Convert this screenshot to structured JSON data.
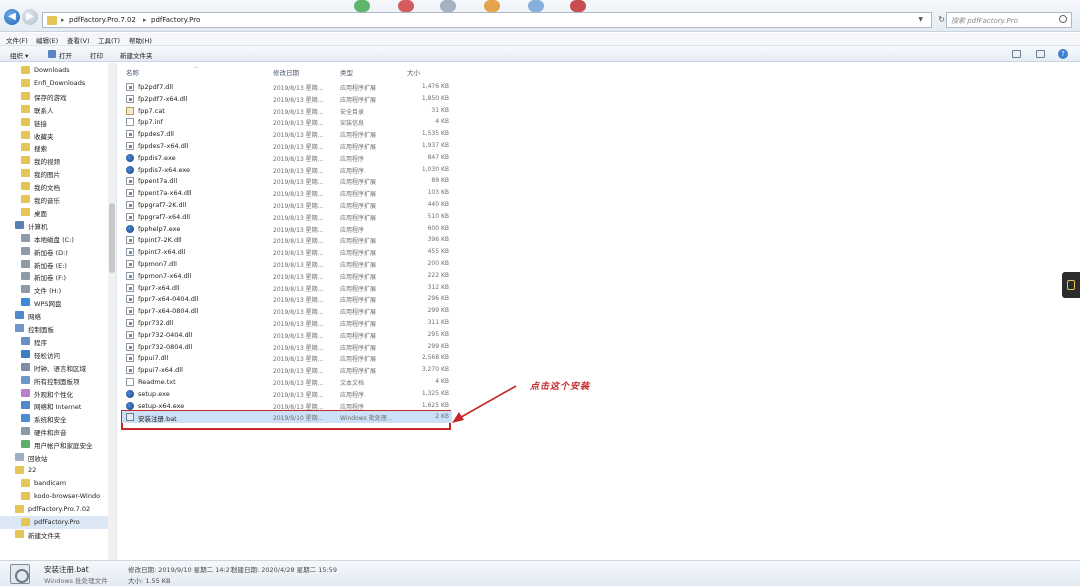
{
  "address": {
    "crumbs": [
      "pdfFactory.Pro.7.02",
      "pdfFactory.Pro"
    ],
    "search_placeholder": "搜索 pdfFactory.Pro"
  },
  "menu": [
    "文件(F)",
    "编辑(E)",
    "查看(V)",
    "工具(T)",
    "帮助(H)"
  ],
  "toolbar": {
    "organize": "组织 ▾",
    "open": "打开",
    "print": "打印",
    "new_folder": "新建文件夹"
  },
  "sidebar": {
    "items": [
      {
        "label": "Downloads",
        "icon": "folder-icon",
        "indent": 1
      },
      {
        "label": "Enfi_Downloads",
        "icon": "folder-icon",
        "indent": 1
      },
      {
        "label": "保存的游戏",
        "icon": "folder-icon",
        "indent": 1
      },
      {
        "label": "联系人",
        "icon": "folder-icon",
        "indent": 1
      },
      {
        "label": "链接",
        "icon": "folder-icon",
        "indent": 1
      },
      {
        "label": "收藏夹",
        "icon": "folder-icon",
        "indent": 1
      },
      {
        "label": "搜索",
        "icon": "folder-icon",
        "indent": 1
      },
      {
        "label": "我的视频",
        "icon": "folder-icon",
        "indent": 1
      },
      {
        "label": "我的图片",
        "icon": "folder-icon",
        "indent": 1
      },
      {
        "label": "我的文档",
        "icon": "folder-icon",
        "indent": 1
      },
      {
        "label": "我的音乐",
        "icon": "folder-icon",
        "indent": 1
      },
      {
        "label": "桌面",
        "icon": "folder-icon",
        "indent": 1
      },
      {
        "label": "计算机",
        "icon": "computer-icon",
        "indent": 0
      },
      {
        "label": "本地磁盘 (C:)",
        "icon": "drive-icon",
        "indent": 1
      },
      {
        "label": "新加卷 (D:)",
        "icon": "drive-icon",
        "indent": 1
      },
      {
        "label": "新加卷 (E:)",
        "icon": "drive-icon",
        "indent": 1
      },
      {
        "label": "新加卷 (F:)",
        "icon": "drive-icon",
        "indent": 1
      },
      {
        "label": "文件 (H:)",
        "icon": "drive-icon",
        "indent": 1
      },
      {
        "label": "WPS网盘",
        "icon": "cloud-icon",
        "indent": 1
      },
      {
        "label": "网络",
        "icon": "network-icon",
        "indent": 0
      },
      {
        "label": "控制面板",
        "icon": "control-panel-icon",
        "indent": 0
      },
      {
        "label": "程序",
        "icon": "programs-icon",
        "indent": 1
      },
      {
        "label": "轻松访问",
        "icon": "accessibility-icon",
        "indent": 1
      },
      {
        "label": "时钟、语言和区域",
        "icon": "clock-icon",
        "indent": 1
      },
      {
        "label": "所有控制面板项",
        "icon": "control-panel-icon",
        "indent": 1
      },
      {
        "label": "外观和个性化",
        "icon": "appearance-icon",
        "indent": 1
      },
      {
        "label": "网络和 Internet",
        "icon": "network-icon",
        "indent": 1
      },
      {
        "label": "系统和安全",
        "icon": "shield-icon",
        "indent": 1
      },
      {
        "label": "硬件和声音",
        "icon": "hardware-icon",
        "indent": 1
      },
      {
        "label": "用户帐户和家庭安全",
        "icon": "user-icon",
        "indent": 1
      },
      {
        "label": "回收站",
        "icon": "recycle-bin-icon",
        "indent": 0
      },
      {
        "label": "22",
        "icon": "folder-icon",
        "indent": 0
      },
      {
        "label": "bandicam",
        "icon": "folder-icon",
        "indent": 1
      },
      {
        "label": "kodo-browser-Windo",
        "icon": "folder-icon",
        "indent": 1
      },
      {
        "label": "pdfFactory.Pro.7.02",
        "icon": "folder-icon",
        "indent": 0
      },
      {
        "label": "pdfFactory.Pro",
        "icon": "folder-icon",
        "indent": 1,
        "selected": true
      },
      {
        "label": "新建文件夹",
        "icon": "folder-icon",
        "indent": 0
      }
    ]
  },
  "columns": {
    "name": "名称",
    "date": "修改日期",
    "type": "类型",
    "size": "大小"
  },
  "files": [
    {
      "name": "fp2pdf7.dll",
      "date": "2019/8/13 星期...",
      "type": "应用程序扩展",
      "size": "1,476 KB",
      "icon": "dll"
    },
    {
      "name": "fp2pdf7-x64.dll",
      "date": "2019/8/13 星期...",
      "type": "应用程序扩展",
      "size": "1,850 KB",
      "icon": "dll"
    },
    {
      "name": "fpp7.cat",
      "date": "2019/8/13 星期...",
      "type": "安全目录",
      "size": "31 KB",
      "icon": "cat"
    },
    {
      "name": "fpp7.inf",
      "date": "2019/8/13 星期...",
      "type": "安装信息",
      "size": "4 KB",
      "icon": "inf"
    },
    {
      "name": "fppdes7.dll",
      "date": "2019/8/13 星期...",
      "type": "应用程序扩展",
      "size": "1,535 KB",
      "icon": "dll"
    },
    {
      "name": "fppdes7-x64.dll",
      "date": "2019/8/13 星期...",
      "type": "应用程序扩展",
      "size": "1,937 KB",
      "icon": "dll"
    },
    {
      "name": "fppdis7.exe",
      "date": "2019/8/13 星期...",
      "type": "应用程序",
      "size": "847 KB",
      "icon": "exe"
    },
    {
      "name": "fppdis7-x64.exe",
      "date": "2019/8/13 星期...",
      "type": "应用程序",
      "size": "1,030 KB",
      "icon": "exe"
    },
    {
      "name": "fppent7a.dll",
      "date": "2019/8/13 星期...",
      "type": "应用程序扩展",
      "size": "89 KB",
      "icon": "dll"
    },
    {
      "name": "fppent7a-x64.dll",
      "date": "2019/8/13 星期...",
      "type": "应用程序扩展",
      "size": "103 KB",
      "icon": "dll"
    },
    {
      "name": "fppgraf7-2K.dll",
      "date": "2019/8/13 星期...",
      "type": "应用程序扩展",
      "size": "440 KB",
      "icon": "dll"
    },
    {
      "name": "fppgraf7-x64.dll",
      "date": "2019/8/13 星期...",
      "type": "应用程序扩展",
      "size": "510 KB",
      "icon": "dll"
    },
    {
      "name": "fpphelp7.exe",
      "date": "2019/8/13 星期...",
      "type": "应用程序",
      "size": "600 KB",
      "icon": "exe"
    },
    {
      "name": "fppint7-2K.dll",
      "date": "2019/8/13 星期...",
      "type": "应用程序扩展",
      "size": "396 KB",
      "icon": "dll"
    },
    {
      "name": "fppint7-x64.dll",
      "date": "2019/8/13 星期...",
      "type": "应用程序扩展",
      "size": "455 KB",
      "icon": "dll"
    },
    {
      "name": "fppmon7.dll",
      "date": "2019/8/13 星期...",
      "type": "应用程序扩展",
      "size": "200 KB",
      "icon": "dll"
    },
    {
      "name": "fppmon7-x64.dll",
      "date": "2019/8/13 星期...",
      "type": "应用程序扩展",
      "size": "222 KB",
      "icon": "dll"
    },
    {
      "name": "fppr7-x64.dll",
      "date": "2019/8/13 星期...",
      "type": "应用程序扩展",
      "size": "312 KB",
      "icon": "dll"
    },
    {
      "name": "fppr7-x64-0404.dll",
      "date": "2019/8/13 星期...",
      "type": "应用程序扩展",
      "size": "296 KB",
      "icon": "dll"
    },
    {
      "name": "fppr7-x64-0804.dll",
      "date": "2019/8/13 星期...",
      "type": "应用程序扩展",
      "size": "299 KB",
      "icon": "dll"
    },
    {
      "name": "fppr732.dll",
      "date": "2019/8/13 星期...",
      "type": "应用程序扩展",
      "size": "311 KB",
      "icon": "dll"
    },
    {
      "name": "fppr732-0404.dll",
      "date": "2019/8/13 星期...",
      "type": "应用程序扩展",
      "size": "295 KB",
      "icon": "dll"
    },
    {
      "name": "fppr732-0804.dll",
      "date": "2019/8/13 星期...",
      "type": "应用程序扩展",
      "size": "299 KB",
      "icon": "dll"
    },
    {
      "name": "fppui7.dll",
      "date": "2019/8/13 星期...",
      "type": "应用程序扩展",
      "size": "2,568 KB",
      "icon": "dll"
    },
    {
      "name": "fppui7-x64.dll",
      "date": "2019/8/13 星期...",
      "type": "应用程序扩展",
      "size": "3,270 KB",
      "icon": "dll"
    },
    {
      "name": "Readme.txt",
      "date": "2019/8/13 星期...",
      "type": "文本文档",
      "size": "4 KB",
      "icon": "txt"
    },
    {
      "name": "setup.exe",
      "date": "2019/8/13 星期...",
      "type": "应用程序",
      "size": "1,325 KB",
      "icon": "exe"
    },
    {
      "name": "setup-x64.exe",
      "date": "2019/8/13 星期...",
      "type": "应用程序",
      "size": "1,625 KB",
      "icon": "exe"
    },
    {
      "name": "安装注册.bat",
      "date": "2019/9/10 星期...",
      "type": "Windows 批处理...",
      "size": "2 KB",
      "icon": "bat",
      "selected": true
    }
  ],
  "annotation": "点击这个安装",
  "details": {
    "name": "安装注册.bat",
    "type": "Windows 批处理文件",
    "modified": "修改日期: 2019/9/10 星期二 14:27",
    "created": "创建日期: 2020/4/28 星期二 15:59",
    "size": "大小: 1.55 KB"
  },
  "colors": {
    "accent": "#c62828",
    "folder": "#e6c558",
    "selection": "#cce0f7"
  }
}
